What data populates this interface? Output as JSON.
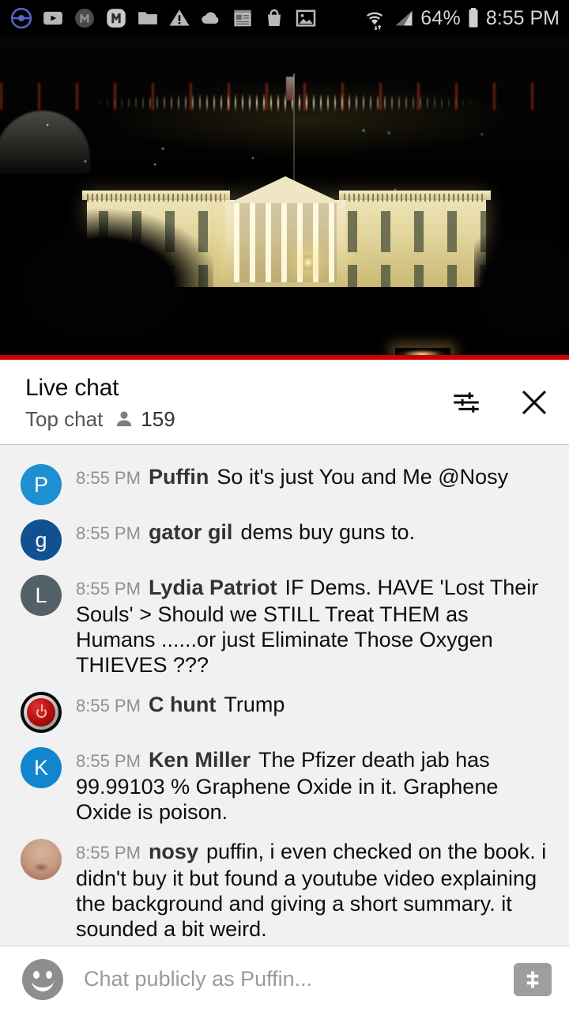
{
  "statusbar": {
    "icons_left": [
      "pokeball-icon",
      "youtube-icon",
      "m-dark-icon",
      "m-light-icon",
      "folder-icon",
      "warning-icon",
      "cloud-icon",
      "notes-icon",
      "shopping-bag-icon",
      "photos-icon"
    ],
    "wifi_icon": "wifi-icon",
    "signal_icon": "cell-signal-icon",
    "battery_percent": "64%",
    "battery_icon": "battery-icon",
    "time": "8:55 PM"
  },
  "video": {
    "name": "white-house-night-livestream",
    "progress_color": "#cc0000"
  },
  "chat_header": {
    "title": "Live chat",
    "mode": "Top chat",
    "viewer_icon": "person-icon",
    "viewer_count": "159",
    "settings_icon": "chat-settings-icon",
    "close_icon": "close-icon"
  },
  "messages": [
    {
      "avatar_letter": "P",
      "avatar_color": "#1e8fd0",
      "avatar_type": "letter",
      "time": "8:55 PM",
      "author": "Puffin",
      "text": "So it's just You and Me @Nosy"
    },
    {
      "avatar_letter": "g",
      "avatar_color": "#10528f",
      "avatar_type": "letter",
      "time": "8:55 PM",
      "author": "gator gil",
      "text": "dems buy guns to."
    },
    {
      "avatar_letter": "L",
      "avatar_color": "#546068",
      "avatar_type": "letter",
      "time": "8:55 PM",
      "author": "Lydia Patriot",
      "text": "IF Dems. HAVE 'Lost Their Souls' > Should we STILL Treat THEM as Humans ......or just Eliminate Those Oxygen THIEVES ???"
    },
    {
      "avatar_letter": "",
      "avatar_color": "#b10e0e",
      "avatar_type": "power-button-photo",
      "time": "8:55 PM",
      "author": "C hunt",
      "text": "Trump"
    },
    {
      "avatar_letter": "K",
      "avatar_color": "#1186cf",
      "avatar_type": "letter",
      "time": "8:55 PM",
      "author": "Ken Miller",
      "text": "The Pfizer death jab has 99.99103 % Graphene Oxide in it. Graphene Oxide is poison."
    },
    {
      "avatar_letter": "",
      "avatar_color": "#c79c84",
      "avatar_type": "nose-photo",
      "time": "8:55 PM",
      "author": "nosy",
      "text": "puffin, i even checked on the book. i didn't buy it but found a youtube video explaining the background and giving a short summary. it sounded a bit weird."
    }
  ],
  "chat_input": {
    "emoji_icon": "emoji-smiley-icon",
    "placeholder": "Chat publicly as Puffin...",
    "superchat_icon": "dollar-superchat-icon"
  }
}
